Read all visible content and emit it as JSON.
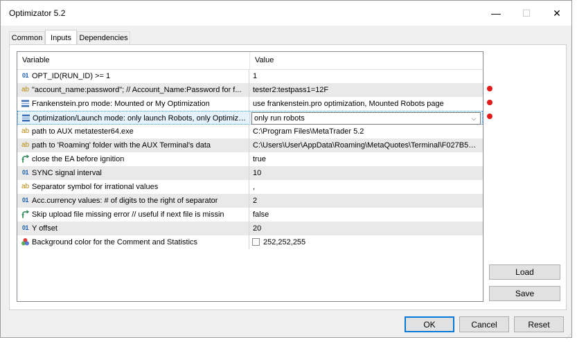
{
  "window": {
    "title": "Optimizator 5.2",
    "minimize_glyph": "—",
    "maximize_glyph": "☐",
    "close_glyph": "✕"
  },
  "tabs": [
    {
      "label": "Common",
      "active": false
    },
    {
      "label": "Inputs",
      "active": true
    },
    {
      "label": "Dependencies",
      "active": false
    }
  ],
  "grid": {
    "columns": [
      "Variable",
      "Value"
    ],
    "rows": [
      {
        "icon": "int-icon",
        "glyph": "01",
        "variable": "OPT_ID(RUN_ID) >= 1",
        "value": "1"
      },
      {
        "icon": "string-icon",
        "glyph": "ab",
        "variable": "\"account_name:password\";  // Account_Name:Password for f...",
        "value": "tester2:testpass1=12F"
      },
      {
        "icon": "enum-icon",
        "glyph": "☰",
        "variable": "Frankenstein.pro mode: Mounted or My Optimization",
        "value": "use frankenstein.pro optimization, Mounted Robots page"
      },
      {
        "icon": "enum-icon",
        "glyph": "☰",
        "variable": "Optimization/Launch mode: only launch Robots, only Optimiza...",
        "value": "only run robots"
      },
      {
        "icon": "string-icon",
        "glyph": "ab",
        "variable": "path to AUX metatester64.exe",
        "value": "C:\\Program Files\\MetaTrader 5.2"
      },
      {
        "icon": "string-icon",
        "glyph": "ab",
        "variable": "path to 'Roaming' folder with the AUX Terminal's data",
        "value": "C:\\Users\\User\\AppData\\Roaming\\MetaQuotes\\Terminal\\F027B5C..."
      },
      {
        "icon": "bool-icon",
        "glyph": "↱",
        "variable": "close the EA before ignition",
        "value": "true"
      },
      {
        "icon": "int-icon",
        "glyph": "01",
        "variable": "SYNC signal interval",
        "value": "10"
      },
      {
        "icon": "string-icon",
        "glyph": "ab",
        "variable": "Separator symbol for irrational values",
        "value": ","
      },
      {
        "icon": "int-icon",
        "glyph": "01",
        "variable": "Acc.currency values: # of digits to the right of separator",
        "value": "2"
      },
      {
        "icon": "bool-icon",
        "glyph": "↱",
        "variable": "Skip upload file missing error // useful if next file is missin",
        "value": "false"
      },
      {
        "icon": "int-icon",
        "glyph": "01",
        "variable": "Y offset",
        "value": "20"
      },
      {
        "icon": "color-icon",
        "glyph": "",
        "variable": "Background color for the Comment and Statistics",
        "value": "252,252,255",
        "swatch_color": "#fcfcff"
      }
    ],
    "selected_row": 3,
    "combo_arrow_glyph": "⌵"
  },
  "modified_markers_color": "#e41b1b",
  "side_buttons": {
    "load": "Load",
    "save": "Save"
  },
  "footer_buttons": {
    "ok": "OK",
    "cancel": "Cancel",
    "reset": "Reset"
  }
}
